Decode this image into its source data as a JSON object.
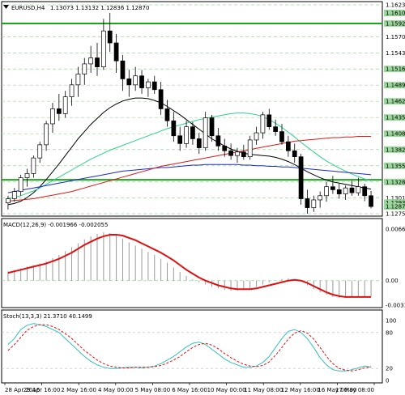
{
  "window": {
    "symbol_label": "EURUSD,H4",
    "ohlc_label": "1.13073 1.13132 1.12836 1.12870"
  },
  "colors": {
    "background": "#ffffff",
    "grid": "#9bd89b",
    "level_line": "#1aa61a",
    "price_tag_bg": "#9bd89b",
    "candles": "#000000",
    "ma_black": "#000000",
    "ma_green": "#2ecf8c",
    "ma_blue": "#1c28c8",
    "ma_red": "#d81b1b",
    "macd_signal": "#e01010",
    "macd_hist": "#999999",
    "stoch_main": "#33bfbf",
    "stoch_signal": "#e01010"
  },
  "chart_data": [
    {
      "type": "candlestick",
      "title": "EURUSD,H4",
      "y_ticks": [
        "1.16235",
        "1.15925",
        "1.15700",
        "1.15430",
        "1.15165",
        "1.14895",
        "1.14625",
        "1.14355",
        "1.14085",
        "1.13820",
        "1.13550",
        "1.13280",
        "1.13015",
        "1.12750"
      ],
      "highlighted_ticks": [
        "1.16100",
        "1.15925",
        "1.15165",
        "1.14895",
        "1.14625",
        "1.14355",
        "1.14085",
        "1.13820",
        "1.13550",
        "1.13280",
        "1.12935",
        "1.12870"
      ],
      "ylim": [
        1.1275,
        1.16235
      ],
      "levels": [
        1.15925,
        1.13315
      ],
      "x_ticks": [
        "28 Apr 2016",
        "29 Apr 16:00",
        "2 May 16:00",
        "4 May 00:00",
        "5 May 08:00",
        "6 May 16:00",
        "10 May 00:00",
        "11 May 08:00",
        "12 May 16:00",
        "16 May 00:00",
        "17 May 08:00"
      ],
      "series": [
        {
          "name": "EURUSD",
          "ohlc": [
            [
              1.1293,
              1.1305,
              1.1282,
              1.13
            ],
            [
              1.13,
              1.1318,
              1.1295,
              1.1312
            ],
            [
              1.1312,
              1.134,
              1.1305,
              1.1335
            ],
            [
              1.1335,
              1.135,
              1.132,
              1.1342
            ],
            [
              1.1342,
              1.1372,
              1.1335,
              1.1368
            ],
            [
              1.1368,
              1.1395,
              1.136,
              1.139
            ],
            [
              1.139,
              1.143,
              1.138,
              1.1425
            ],
            [
              1.1425,
              1.146,
              1.141,
              1.145
            ],
            [
              1.145,
              1.1475,
              1.143,
              1.1442
            ],
            [
              1.1442,
              1.148,
              1.1435,
              1.147
            ],
            [
              1.147,
              1.15,
              1.1455,
              1.149
            ],
            [
              1.149,
              1.152,
              1.147,
              1.1508
            ],
            [
              1.1508,
              1.1535,
              1.149,
              1.1525
            ],
            [
              1.1525,
              1.1555,
              1.151,
              1.1535
            ],
            [
              1.1535,
              1.156,
              1.1505,
              1.152
            ],
            [
              1.152,
              1.16,
              1.1515,
              1.158
            ],
            [
              1.158,
              1.161,
              1.1545,
              1.156
            ],
            [
              1.156,
              1.1575,
              1.151,
              1.153
            ],
            [
              1.153,
              1.154,
              1.148,
              1.15
            ],
            [
              1.15,
              1.1515,
              1.147,
              1.149
            ],
            [
              1.149,
              1.152,
              1.148,
              1.1505
            ],
            [
              1.1505,
              1.1515,
              1.1475,
              1.1485
            ],
            [
              1.1485,
              1.15,
              1.147,
              1.1495
            ],
            [
              1.1495,
              1.1505,
              1.1475,
              1.1482
            ],
            [
              1.1482,
              1.1495,
              1.144,
              1.145
            ],
            [
              1.145,
              1.1465,
              1.142,
              1.143
            ],
            [
              1.143,
              1.1445,
              1.1395,
              1.1405
            ],
            [
              1.1405,
              1.142,
              1.138,
              1.1392
            ],
            [
              1.1392,
              1.143,
              1.1385,
              1.142
            ],
            [
              1.142,
              1.1428,
              1.139,
              1.14
            ],
            [
              1.14,
              1.141,
              1.1375,
              1.1385
            ],
            [
              1.1385,
              1.1445,
              1.138,
              1.1435
            ],
            [
              1.1435,
              1.144,
              1.1395,
              1.1405
            ],
            [
              1.1405,
              1.1418,
              1.138,
              1.1388
            ],
            [
              1.1388,
              1.14,
              1.137,
              1.138
            ],
            [
              1.138,
              1.1392,
              1.1365,
              1.1372
            ],
            [
              1.1372,
              1.1385,
              1.136,
              1.1378
            ],
            [
              1.1378,
              1.139,
              1.1365,
              1.137
            ],
            [
              1.137,
              1.1405,
              1.1365,
              1.1398
            ],
            [
              1.1398,
              1.142,
              1.139,
              1.141
            ],
            [
              1.141,
              1.1445,
              1.14,
              1.144
            ],
            [
              1.144,
              1.145,
              1.1415,
              1.142
            ],
            [
              1.142,
              1.1432,
              1.1405,
              1.1412
            ],
            [
              1.1412,
              1.1425,
              1.139,
              1.1395
            ],
            [
              1.1395,
              1.1405,
              1.137,
              1.138
            ],
            [
              1.138,
              1.1392,
              1.136,
              1.137
            ],
            [
              1.137,
              1.1375,
              1.129,
              1.13
            ],
            [
              1.13,
              1.1315,
              1.1275,
              1.1285
            ],
            [
              1.1285,
              1.1305,
              1.1278,
              1.1298
            ],
            [
              1.1298,
              1.1312,
              1.1285,
              1.1305
            ],
            [
              1.1305,
              1.1328,
              1.1295,
              1.132
            ],
            [
              1.132,
              1.1338,
              1.1308,
              1.1315
            ],
            [
              1.1315,
              1.1325,
              1.13,
              1.1308
            ],
            [
              1.1308,
              1.1322,
              1.1298,
              1.1318
            ],
            [
              1.1318,
              1.133,
              1.1305,
              1.131
            ],
            [
              1.131,
              1.1335,
              1.1305,
              1.132
            ],
            [
              1.132,
              1.1325,
              1.1296,
              1.1305
            ],
            [
              1.1305,
              1.1313,
              1.1284,
              1.1287
            ]
          ]
        },
        {
          "name": "MA black",
          "values": [
            1.129,
            1.1292,
            1.1296,
            1.1302,
            1.131,
            1.132,
            1.1332,
            1.1345,
            1.1358,
            1.1372,
            1.1386,
            1.14,
            1.1412,
            1.1424,
            1.1434,
            1.1444,
            1.1452,
            1.1458,
            1.1463,
            1.1466,
            1.1468,
            1.1468,
            1.1467,
            1.1464,
            1.146,
            1.1454,
            1.1447,
            1.144,
            1.1432,
            1.1424,
            1.1416,
            1.1408,
            1.14,
            1.1394,
            1.1388,
            1.1383,
            1.1379,
            1.1376,
            1.1374,
            1.1373,
            1.1372,
            1.1371,
            1.1369,
            1.1366,
            1.1362,
            1.1357,
            1.1351,
            1.1345,
            1.134,
            1.1335,
            1.1331,
            1.1328,
            1.1326,
            1.1324,
            1.1322,
            1.132,
            1.1318,
            1.1316
          ]
        },
        {
          "name": "MA green",
          "values": [
            1.13,
            1.1302,
            1.1305,
            1.1309,
            1.1313,
            1.1318,
            1.1324,
            1.133,
            1.1336,
            1.1342,
            1.1348,
            1.1354,
            1.136,
            1.1366,
            1.1371,
            1.1376,
            1.1381,
            1.1385,
            1.1389,
            1.1393,
            1.1397,
            1.1401,
            1.1405,
            1.1409,
            1.1413,
            1.1417,
            1.142,
            1.1423,
            1.1426,
            1.1429,
            1.1432,
            1.1434,
            1.1436,
            1.1438,
            1.144,
            1.1442,
            1.1443,
            1.1443,
            1.1442,
            1.144,
            1.1437,
            1.1432,
            1.1426,
            1.1419,
            1.1411,
            1.1403,
            1.1394,
            1.1386,
            1.1378,
            1.137,
            1.1363,
            1.1357,
            1.1351,
            1.1346,
            1.1341,
            1.1337,
            1.1333,
            1.133
          ]
        },
        {
          "name": "MA blue",
          "values": [
            1.131,
            1.1312,
            1.1314,
            1.1316,
            1.1318,
            1.132,
            1.1322,
            1.1324,
            1.1326,
            1.1328,
            1.133,
            1.1332,
            1.1334,
            1.1336,
            1.1338,
            1.134,
            1.1342,
            1.1344,
            1.1346,
            1.1347,
            1.1348,
            1.1349,
            1.135,
            1.1351,
            1.1352,
            1.1352,
            1.1353,
            1.1354,
            1.1355,
            1.1356,
            1.1356,
            1.1357,
            1.1357,
            1.1357,
            1.1357,
            1.1357,
            1.1357,
            1.1356,
            1.1356,
            1.1355,
            1.1355,
            1.1354,
            1.1354,
            1.1353,
            1.1353,
            1.1352,
            1.1351,
            1.135,
            1.1349,
            1.1348,
            1.1347,
            1.1346,
            1.1345,
            1.1344,
            1.1343,
            1.1342,
            1.1341,
            1.134
          ]
        },
        {
          "name": "MA red",
          "values": [
            1.1296,
            1.1297,
            1.1298,
            1.1299,
            1.13,
            1.1302,
            1.1304,
            1.1306,
            1.1308,
            1.131,
            1.1312,
            1.1315,
            1.1318,
            1.1321,
            1.1324,
            1.1327,
            1.133,
            1.1333,
            1.1336,
            1.1339,
            1.1342,
            1.1345,
            1.1348,
            1.1351,
            1.1354,
            1.1356,
            1.1358,
            1.136,
            1.1362,
            1.1364,
            1.1366,
            1.1368,
            1.137,
            1.1372,
            1.1374,
            1.1376,
            1.1378,
            1.138,
            1.1382,
            1.1384,
            1.1386,
            1.1388,
            1.139,
            1.1392,
            1.1394,
            1.1396,
            1.1397,
            1.1398,
            1.1399,
            1.14,
            1.1401,
            1.1402,
            1.1402,
            1.1403,
            1.1403,
            1.1404,
            1.1404,
            1.1404
          ]
        }
      ]
    },
    {
      "type": "bar",
      "title": "MACD(12,26,9) -0.001966 -0.002055",
      "y_ticks": [
        "0.006626",
        "0.00",
        "-0.003147"
      ],
      "ylim": [
        -0.00315,
        0.00663
      ],
      "series": [
        {
          "name": "MACD",
          "values": [
            0.0012,
            0.0014,
            0.0016,
            0.0018,
            0.002,
            0.0022,
            0.0025,
            0.0029,
            0.0033,
            0.0038,
            0.0043,
            0.0048,
            0.0053,
            0.0057,
            0.006,
            0.0062,
            0.0061,
            0.0058,
            0.0054,
            0.0049,
            0.0045,
            0.0041,
            0.0037,
            0.0033,
            0.0028,
            0.0023,
            0.0017,
            0.0011,
            0.0006,
            0.0002,
            -0.0002,
            -0.0005,
            -0.0008,
            -0.001,
            -0.0012,
            -0.0013,
            -0.0013,
            -0.0012,
            -0.001,
            -0.0008,
            -0.0005,
            -0.0002,
            0.0,
            0.0002,
            0.0003,
            0.0002,
            -0.0001,
            -0.0006,
            -0.0011,
            -0.0015,
            -0.0018,
            -0.0021,
            -0.0022,
            -0.0022,
            -0.0021,
            -0.002,
            -0.002,
            -0.002
          ]
        },
        {
          "name": "Signal",
          "values": [
            0.001,
            0.0012,
            0.0014,
            0.0016,
            0.0018,
            0.002,
            0.0022,
            0.0025,
            0.0028,
            0.0032,
            0.0036,
            0.0041,
            0.0046,
            0.005,
            0.0054,
            0.0057,
            0.0059,
            0.0059,
            0.0058,
            0.0055,
            0.0052,
            0.0048,
            0.0044,
            0.004,
            0.0036,
            0.0031,
            0.0026,
            0.002,
            0.0014,
            0.0009,
            0.0004,
            0.0,
            -0.0003,
            -0.0006,
            -0.0008,
            -0.001,
            -0.0011,
            -0.0011,
            -0.0011,
            -0.001,
            -0.0008,
            -0.0006,
            -0.0004,
            -0.0002,
            0.0,
            0.0001,
            0.0,
            -0.0003,
            -0.0007,
            -0.0011,
            -0.0015,
            -0.0018,
            -0.002,
            -0.0021,
            -0.0021,
            -0.0021,
            -0.0021,
            -0.0021
          ]
        }
      ]
    },
    {
      "type": "line",
      "title": "Stoch(13,3,3) 21.3710 40.1499",
      "y_ticks": [
        "100",
        "80",
        "20",
        "0"
      ],
      "ylim": [
        0,
        100
      ],
      "series": [
        {
          "name": "%K",
          "values": [
            60,
            70,
            85,
            92,
            95,
            93,
            90,
            85,
            80,
            70,
            60,
            50,
            40,
            32,
            26,
            22,
            20,
            20,
            21,
            22,
            22,
            21,
            22,
            24,
            28,
            34,
            40,
            48,
            56,
            62,
            64,
            60,
            52,
            44,
            36,
            30,
            26,
            22,
            22,
            24,
            30,
            40,
            55,
            70,
            82,
            85,
            80,
            70,
            55,
            38,
            26,
            18,
            16,
            16,
            18,
            21,
            24,
            22
          ]
        },
        {
          "name": "%D",
          "values": [
            50,
            60,
            72,
            84,
            90,
            93,
            93,
            90,
            85,
            78,
            70,
            60,
            50,
            42,
            34,
            28,
            24,
            22,
            21,
            21,
            22,
            22,
            22,
            23,
            25,
            29,
            34,
            40,
            48,
            55,
            60,
            62,
            59,
            53,
            45,
            38,
            32,
            27,
            24,
            23,
            25,
            31,
            42,
            55,
            69,
            79,
            83,
            79,
            69,
            55,
            40,
            28,
            20,
            17,
            16,
            18,
            21,
            23
          ]
        }
      ]
    }
  ]
}
